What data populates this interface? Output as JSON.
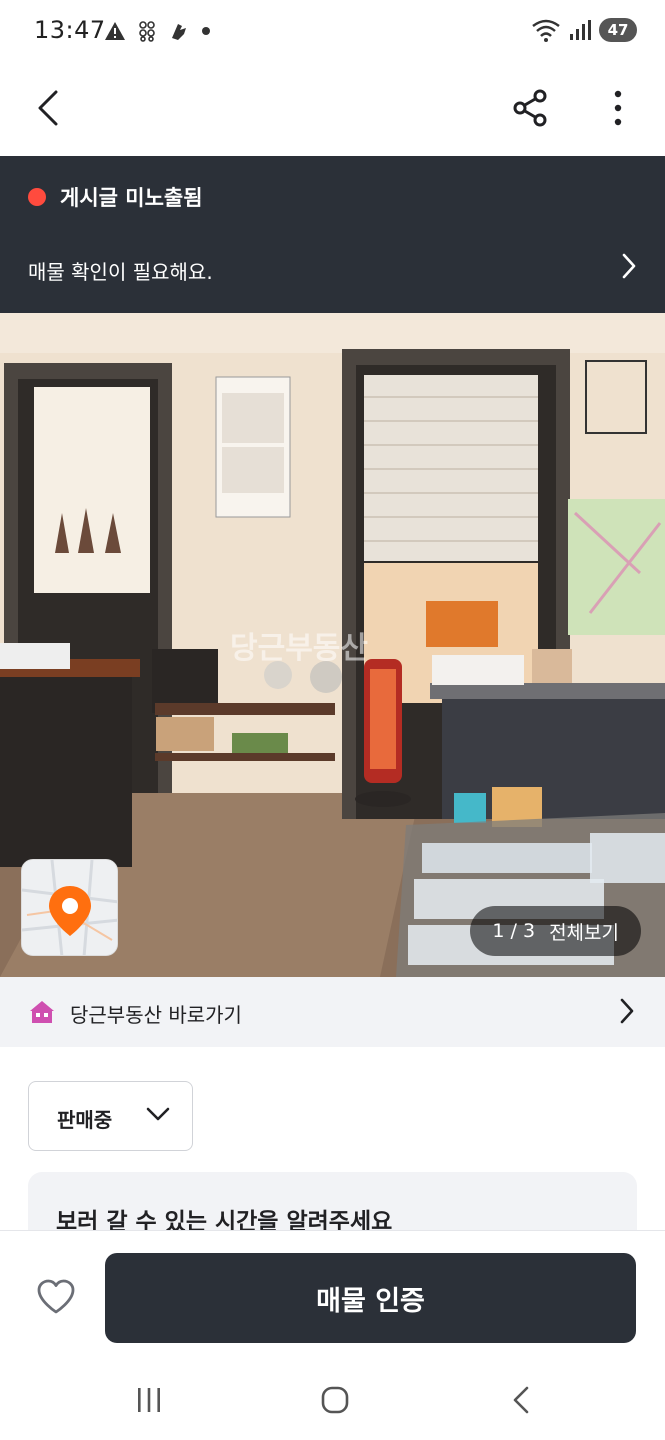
{
  "status_bar": {
    "time": "13:47",
    "battery": "47",
    "left_icons": [
      "warning-icon",
      "hash-grid-icon",
      "hand-icon",
      "dot"
    ],
    "right_icons": [
      "wifi-icon",
      "signal-icon",
      "battery-icon"
    ]
  },
  "app_bar": {
    "back_icon": "chevron-left-icon",
    "share_icon": "share-icon",
    "more_icon": "more-vertical-icon"
  },
  "banner": {
    "status_label": "게시글 미노출됨",
    "message": "매물 확인이 필요해요.",
    "status_color": "#ff4b3e"
  },
  "photo": {
    "watermark": "당근부동산",
    "current": "1",
    "total": "3",
    "counter": "1 / 3",
    "view_all": "전체보기"
  },
  "realty_link": {
    "label": "당근부동산 바로가기"
  },
  "sale_status": {
    "selected": "판매중"
  },
  "visit_card": {
    "title": "보러 갈 수 있는 시간을 알려주세요"
  },
  "action_bar": {
    "verify_label": "매물 인증"
  },
  "colors": {
    "dark": "#2b3038",
    "accent": "#ff6f0f",
    "alert": "#ff4b3e"
  }
}
